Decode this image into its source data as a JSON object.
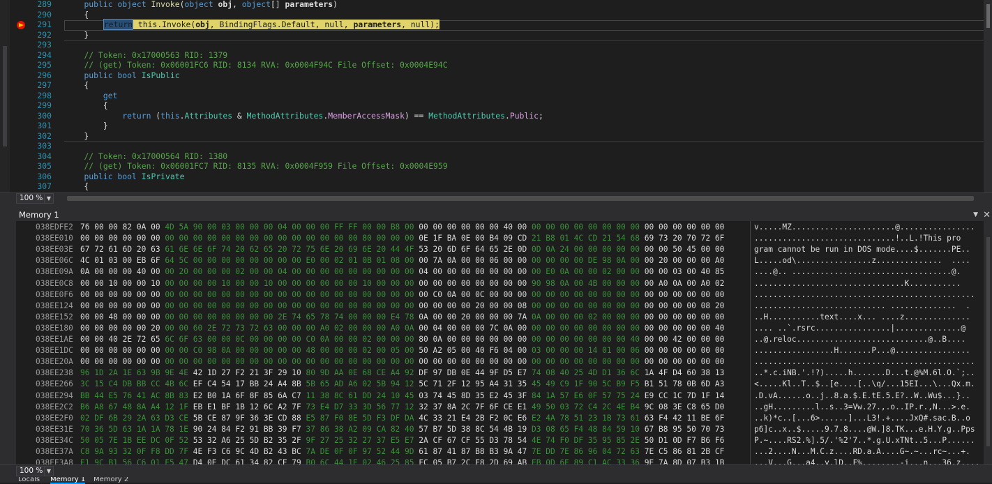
{
  "editor": {
    "lines": [
      {
        "n": "289",
        "html": "    <span class='kw'>public</span> <span class='kw'>object</span> <span class='mt'>Invoke</span>(<span class='kw'>object</span> <span class='bold'>obj</span>, <span class='kw'>object</span>[] <span class='bold'>parameters</span>)"
      },
      {
        "n": "290",
        "html": "    {"
      },
      {
        "n": "291",
        "html": "        <span class='hl-word'>return</span><span class='hl-stmt'> this.Invoke(<b>obj</b>, BindingFlags.Default, null, <b>parameters</b>, null);</span>"
      },
      {
        "n": "292",
        "html": "    }"
      },
      {
        "n": "293",
        "html": ""
      },
      {
        "n": "294",
        "html": "    <span class='cm'>// Token: 0x17000563 RID: 1379</span>"
      },
      {
        "n": "295",
        "html": "    <span class='cm'>// (get) Token: 0x06001FC6 RID: 8134 RVA: 0x0004F94C File Offset: 0x0004E94C</span>"
      },
      {
        "n": "296",
        "html": "    <span class='kw'>public</span> <span class='kw'>bool</span> <span class='ty'>IsPublic</span>"
      },
      {
        "n": "297",
        "html": "    {"
      },
      {
        "n": "298",
        "html": "        <span class='kw'>get</span>"
      },
      {
        "n": "299",
        "html": "        {"
      },
      {
        "n": "300",
        "html": "            <span class='kw'>return</span> (<span class='kw'>this</span>.<span class='ty'>Attributes</span> &amp; <span class='ty'>MethodAttributes</span>.<span class='pp'>MemberAccessMask</span>) == <span class='ty'>MethodAttributes</span>.<span class='pp'>Public</span>;"
      },
      {
        "n": "301",
        "html": "        }"
      },
      {
        "n": "302",
        "html": "    }"
      },
      {
        "n": "303",
        "html": ""
      },
      {
        "n": "304",
        "html": "    <span class='cm'>// Token: 0x17000564 RID: 1380</span>"
      },
      {
        "n": "305",
        "html": "    <span class='cm'>// (get) Token: 0x06001FC7 RID: 8135 RVA: 0x0004F959 File Offset: 0x0004E959</span>"
      },
      {
        "n": "306",
        "html": "    <span class='kw'>public</span> <span class='kw'>bool</span> <span class='ty'>IsPrivate</span>"
      },
      {
        "n": "307",
        "html": "    {"
      }
    ],
    "zoom": "100 %"
  },
  "memory": {
    "title": "Memory 1",
    "zoom": "100 %",
    "tabs": [
      "Locals",
      "Memory 1",
      "Memory 2"
    ],
    "rows": [
      {
        "a": "038EDFE2",
        "h": "76 00 00 82 0A 00 4D 5A 90 00 03 00 00 00 04 00 00 00 FF FF 00 00 B8 00 00 00 00 00 00 00 40 00 00 00 00 00 00 00 00 00 00 00 00 00 00 00",
        "s": "v.....MZ......................@................"
      },
      {
        "a": "038EE010",
        "h": "00 00 00 00 00 00 00 00 00 00 00 00 00 00 00 00 00 00 00 00 80 00 00 00 0E 1F BA 0E 00 B4 09 CD 21 B8 01 4C CD 21 54 68 69 73 20 70 72 6F",
        "s": "..............................!..L.!This pro"
      },
      {
        "a": "038EE03E",
        "h": "67 72 61 6D 20 63 61 6E 6E 6F 74 20 62 65 20 72 75 6E 20 69 6E 20 44 4F 53 20 6D 6F 64 65 2E 0D 0D 0A 24 00 00 00 00 00 00 00 50 45 00 00",
        "s": "gram cannot be run in DOS mode....$.......PE.."
      },
      {
        "a": "038EE06C",
        "h": "4C 01 03 00 EB 6F 64 5C 00 00 00 00 00 00 00 00 E0 00 02 01 0B 01 08 00 00 7A 0A 00 00 06 00 00 00 00 00 00 DE 98 0A 00 00 20 00 00 00 A0",
        "s": "L.....od\\................z..............  ...."
      },
      {
        "a": "038EE09A",
        "h": "0A 00 00 00 40 00 00 20 00 00 00 02 00 00 04 00 00 00 00 00 00 00 00 00 04 00 00 00 00 00 00 00 00 E0 0A 00 00 02 00 00 00 00 03 00 40 85",
        "s": "....@.. ..................................@."
      },
      {
        "a": "038EE0C8",
        "h": "00 00 10 00 00 10 00 00 00 00 10 00 00 10 00 00 00 00 00 00 10 00 00 00 00 00 00 00 00 00 00 00 90 98 0A 00 4B 00 00 00 00 A0 0A 00 A0 02",
        "s": "................................K..........."
      },
      {
        "a": "038EE0F6",
        "h": "00 00 00 00 00 00 00 00 00 00 00 00 00 00 00 00 00 00 00 00 00 00 00 00 00 C0 0A 00 0C 00 00 00 00 00 00 00 00 00 00 00 00 00 00 00 00 00",
        "s": "..............................................."
      },
      {
        "a": "038EE124",
        "h": "00 00 00 00 00 00 00 00 00 00 00 00 00 00 00 00 00 00 00 00 00 00 00 00 00 00 00 00 20 00 00 08 00 00 00 00 00 00 00 00 00 00 00 00 08 20",
        "s": "............................ ..............  ."
      },
      {
        "a": "038EE152",
        "h": "00 00 48 00 00 00 00 00 00 00 00 00 00 00 2E 74 65 78 74 00 00 00 E4 78 0A 00 00 20 00 00 00 7A 0A 00 00 00 02 00 00 00 00 00 00 00 00 00",
        "s": "..H...........text....x... ....z.............."
      },
      {
        "a": "038EE180",
        "h": "00 00 00 00 00 20 00 00 60 2E 72 73 72 63 00 00 00 A0 02 00 00 00 A0 0A 00 04 00 00 00 7C 0A 00 00 00 00 00 00 00 00 00 00 00 00 00 00 40",
        "s": ".... ..`.rsrc................|..............@"
      },
      {
        "a": "038EE1AE",
        "h": "00 00 40 2E 72 65 6C 6F 63 00 00 0C 00 00 00 00 C0 0A 00 00 02 00 00 00 80 0A 00 00 00 00 00 00 00 00 00 00 00 00 00 40 00 00 42 00 00 00",
        "s": "..@.reloc............................@..B...."
      },
      {
        "a": "038EE1DC",
        "h": "00 00 00 00 00 00 00 00 C0 98 0A 00 00 00 00 00 48 00 00 00 02 00 05 00 50 A2 05 00 40 F6 04 00 03 00 00 00 14 01 00 06 00 00 00 00 00 00",
        "s": ".................H.......P...@................"
      },
      {
        "a": "038EE20A",
        "h": "00 00 00 00 00 00 00 00 00 00 00 00 00 00 00 00 00 00 00 00 00 00 00 00 00 00 00 00 00 00 00 00 00 00 00 00 00 00 00 00 00 00 00 00 00 00",
        "s": "..............................................."
      },
      {
        "a": "038EE238",
        "h": "96 1D 2A 1E 63 9B 9E 4E 42 1D 27 F2 21 3F 29 10 80 9D AA 0E 68 CE A4 92 DF 97 DB 0E 44 9F D5 E7 74 08 40 25 4D D1 36 6C 1A 4F D4 60 38 13",
        "s": "..*.c.iNB.'.!?).....h.......D...t.@%M.6l.O.`;.."
      },
      {
        "a": "038EE266",
        "h": "3C 15 C4 DB BB CC 4B 6C EF C4 54 17 BB 24 A4 8B 5B 65 AD A6 02 5B 94 12 5C 71 2F 12 95 A4 31 35 45 49 C9 1F 90 5C B9 F5 B1 51 78 0B 6D A3",
        "s": "<.....Kl..T..$..[e....[..\\q/...15EI...\\...Qx.m."
      },
      {
        "a": "038EE294",
        "h": "BB 44 E5 76 41 AC 8B 83 E2 B0 1A 6F 8F 85 6A C7 11 38 8C 61 DD 24 10 45 03 74 45 8D 35 E2 45 3F 84 1A 57 E6 0F 57 75 24 E9 CC 1C 7D 1F 14",
        "s": ".D.vA......o..j..8.a.$.E.tE.5.E?..W..Wu$...}.."
      },
      {
        "a": "038EE2C2",
        "h": "B6 A8 67 48 8A A4 12 1F EB E1 BF 1B 12 6C A2 7F 73 E4 D7 33 3D 56 77 12 32 37 8A 2C 7F 6F CE E1 49 50 03 72 C4 2C 4E B4 9C 08 3E C8 65 D0",
        "s": "..gH.........l..s..3=Vw.27.,.o..IP.r.,N...>.e."
      },
      {
        "a": "038EE2F0",
        "h": "02 DF 6B 29 2A 63 D3 CE 5B CE 87 9F 36 3E CD 88 E5 87 F0 8E 5D F3 DF DA 4C 33 21 E4 2B F2 0C E6 E2 4A 78 51 23 1B 73 61 63 F4 42 11 BE 6F",
        "s": "..k)*c..[...6>......]...L3!.+....JxQ#.sac.B..o"
      },
      {
        "a": "038EE31E",
        "h": "70 36 5D 63 1A 1A 78 1E 90 24 84 F2 91 BB 39 F7 37 86 38 A2 09 CA 82 40 57 B7 5D 38 8C 54 4B 19 D3 08 65 F4 48 84 59 10 67 B8 95 50 70 73",
        "s": "p6]c..x..$.....9.7.8....@W.]8.TK...e.H.Y.g..Pps"
      },
      {
        "a": "038EE34C",
        "h": "50 05 7E 1B EE DC 0F 52 53 32 A6 25 5D B2 35 2F 9F 27 25 32 27 37 E5 E7 2A CF 67 CF 55 D3 78 54 4E 74 F0 DF 35 95 85 2E 50 D1 0D F7 B6 F6",
        "s": "P.~....RS2.%].5/.'%2'7..*.g.U.xTNt..5...P......"
      },
      {
        "a": "038EE37A",
        "h": "C8 9A 93 32 0F F8 DD 7F 4E F3 C6 9C 4D B2 43 BC 7A DE 0F 0F 97 52 44 9D 61 87 41 87 B8 B3 9A 47 7E DD 7E 86 96 04 72 63 7E C5 86 81 2B CF",
        "s": "...2....N...M.C.z....RD.a.A....G~.~...rc~...+."
      },
      {
        "a": "038EE3A8",
        "h": "E1 9C B1 56 C6 01 E5 47 D4 0E DC 61 34 82 CF 79 B0 6C 44 1E 02 46 25 85 FC 05 B7 2C F8 2D 69 AB EB 0D 6E 89 C1 AC 33 36 9E 7A 8D 07 B3 1B",
        "s": "...V...G...a4..y.lD..F%........-i...n...36.z...."
      }
    ]
  }
}
